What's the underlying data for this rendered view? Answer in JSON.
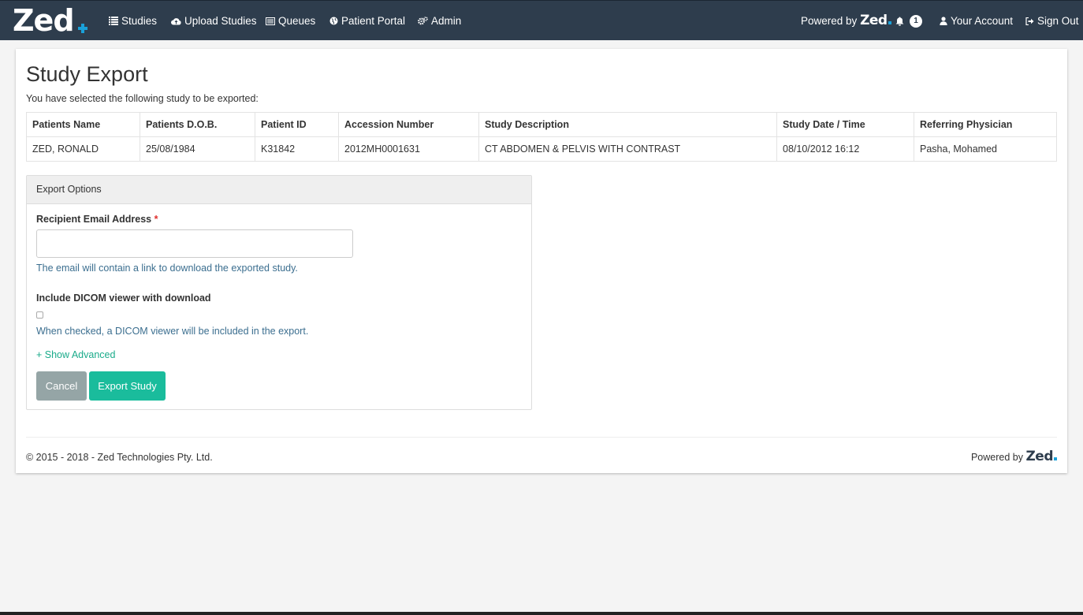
{
  "nav": {
    "logo": "Zed",
    "items": [
      {
        "label": "Studies",
        "icon": "list-icon"
      },
      {
        "label": "Upload Studies",
        "icon": "cloud-upload-icon"
      },
      {
        "label": "Queues",
        "icon": "queue-list-icon"
      },
      {
        "label": "Patient Portal",
        "icon": "globe-icon"
      },
      {
        "label": "Admin",
        "icon": "gears-icon"
      }
    ],
    "powered_by": "Powered by",
    "powered_brand": "Zed",
    "notification_count": "1",
    "account": "Your Account",
    "signout": "Sign Out"
  },
  "page": {
    "title": "Study Export",
    "subtitle": "You have selected the following study to be exported:"
  },
  "table": {
    "headers": [
      "Patients Name",
      "Patients D.O.B.",
      "Patient ID",
      "Accession Number",
      "Study Description",
      "Study Date / Time",
      "Referring Physician"
    ],
    "rows": [
      [
        "ZED, RONALD",
        "25/08/1984",
        "K31842",
        "2012MH0001631",
        "CT ABDOMEN & PELVIS WITH CONTRAST",
        "08/10/2012 16:12",
        "Pasha, Mohamed"
      ]
    ]
  },
  "export": {
    "heading": "Export Options",
    "email_label": "Recipient Email Address",
    "required_mark": "*",
    "email_value": "",
    "email_help": "The email will contain a link to download the exported study.",
    "dicom_label": "Include DICOM viewer with download",
    "dicom_checked": false,
    "dicom_help": "When checked, a DICOM viewer will be included in the export.",
    "show_advanced": "+ Show Advanced",
    "cancel": "Cancel",
    "submit": "Export Study"
  },
  "footer": {
    "copyright": "© 2015 - 2018 - Zed Technologies Pty. Ltd.",
    "powered_by": "Powered by",
    "powered_brand": "Zed"
  },
  "colors": {
    "navbar": "#2e3d4d",
    "accent": "#1abc9c",
    "brand_dot": "#1aa1d9",
    "cancel": "#95a5a6",
    "help_text": "#3b6e8f"
  }
}
